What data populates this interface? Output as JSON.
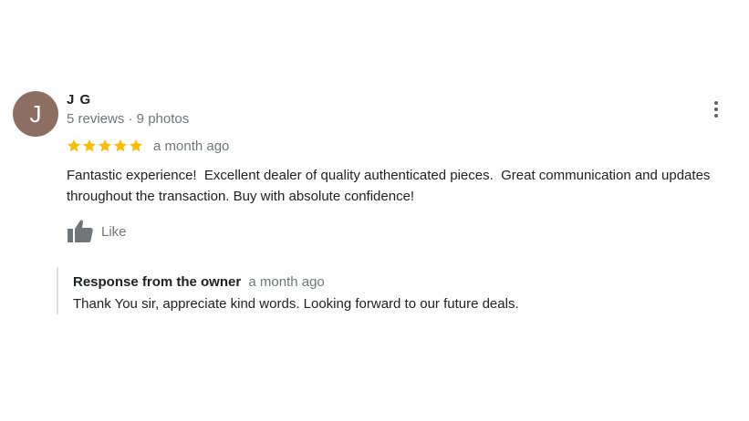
{
  "review": {
    "avatar_letter": "J",
    "avatar_color": "#8d6e63",
    "author_name": "J G",
    "author_meta": "5 reviews · 9 photos",
    "rating": 5,
    "rating_max": 5,
    "star_color": "#fbbc04",
    "time_ago": "a month ago",
    "text": "Fantastic experience!  Excellent dealer of quality authenticated pieces.  Great communication and updates throughout the transaction. Buy with absolute confidence!",
    "like_label": "Like",
    "like_icon": "thumb-up-icon",
    "more_icon": "more-vert-icon"
  },
  "owner_response": {
    "title": "Response from the owner",
    "time_ago": "a month ago",
    "text": "Thank You sir, appreciate kind words. Looking forward to our future deals."
  }
}
